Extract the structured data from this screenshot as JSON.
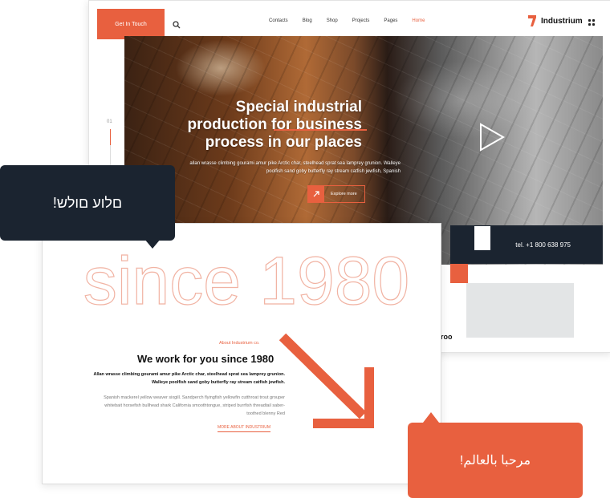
{
  "colors": {
    "accent": "#e8603f",
    "dark": "#1b2430",
    "grey": "#e3e5e6"
  },
  "header": {
    "cta_label": "Get In Touch",
    "search_icon": "search-icon",
    "nav": [
      "Contacts",
      "Blog",
      "Shop",
      "Projects",
      "Pages",
      "Home"
    ],
    "brand": "Industrium",
    "menu_icon": "grid-icon"
  },
  "hero": {
    "title": "Special industrial production for business process in our places",
    "subtitle": "allan wrasse climbing gourami amur pike Arctic char, steelhead sprat sea lamprey grunion. Walleye poolfish sand goby butterfly ray stream catfish jewfish, Spanish",
    "button_label": "Explore more",
    "slide_number": "01",
    "play_icon": "play-icon"
  },
  "contact": {
    "phone": "tel. +1 800 638 975"
  },
  "about": {
    "since_text": "since 1980",
    "kicker": "About Industrium co.",
    "title": "We work for you since 1980",
    "lead": "Allan wrasse climbing gourami amur pike Arctic char, steelhead sprat sea lamprey grunion. Walleye poolfish sand goby butterfly ray stream catfish jewfish.",
    "body": "Spanish mackerel yellow weaver sixgill. Sandperch flyingfish yellowfin cutthroat trout grouper whitebait horsefish bullhead shark California smoothtongue, striped burrfish threadtail saber-toothed blenny Red",
    "link_label": "MORE ABOUT INDUSTRIUM"
  },
  "back_fragment": "roo",
  "bubbles": {
    "hebrew": "!םלוע םולש",
    "arabic": "!مرحبا بالعالم"
  }
}
